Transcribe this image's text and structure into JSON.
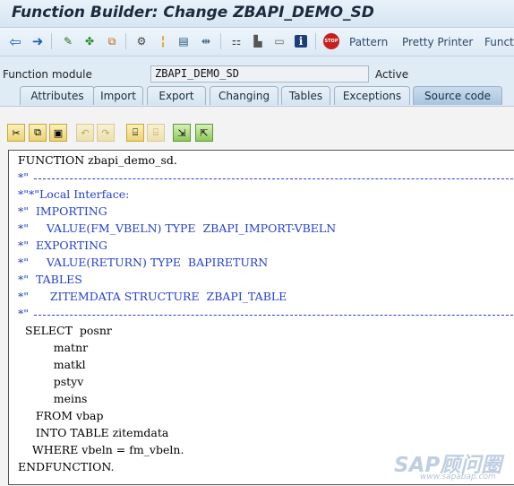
{
  "window": {
    "title": "Function Builder: Change ZBAPI_DEMO_SD"
  },
  "toolbar": {
    "buttons": [
      {
        "name": "back",
        "glyph": "⇦",
        "color": "#1a5fb0"
      },
      {
        "name": "forward",
        "glyph": "➜",
        "color": "#1a5fb0"
      },
      {
        "name": "display-change",
        "glyph": "✎",
        "color": "#2a6b1e"
      },
      {
        "name": "check",
        "glyph": "✤",
        "color": "#2d8a2d"
      },
      {
        "name": "activate",
        "glyph": "⧉",
        "color": "#c0620a"
      },
      {
        "name": "where-used",
        "glyph": "⚙",
        "color": "#444"
      },
      {
        "name": "set-breakpoint",
        "glyph": "¦",
        "color": "#d9a000"
      },
      {
        "name": "object-list",
        "glyph": "▤",
        "color": "#24527a"
      },
      {
        "name": "navigation",
        "glyph": "⇹",
        "color": "#24527a"
      },
      {
        "name": "hierarchy",
        "glyph": "⚏",
        "color": "#444"
      },
      {
        "name": "print",
        "glyph": "▙",
        "color": "#555"
      },
      {
        "name": "layout",
        "glyph": "▭",
        "color": "#666"
      },
      {
        "name": "information",
        "glyph": "i",
        "color": "#ffffff"
      },
      {
        "name": "stop",
        "glyph": "STOP",
        "color": "#ffffff"
      }
    ],
    "links": [
      "Pattern",
      "Pretty Printer",
      "Functi"
    ]
  },
  "function_module": {
    "label": "Function module",
    "value": "ZBAPI_DEMO_SD",
    "status": "Active"
  },
  "tabs": [
    {
      "label": "Attributes",
      "active": false
    },
    {
      "label": "Import",
      "active": false
    },
    {
      "label": "Export",
      "active": false
    },
    {
      "label": "Changing",
      "active": false
    },
    {
      "label": "Tables",
      "active": false
    },
    {
      "label": "Exceptions",
      "active": false
    },
    {
      "label": "Source code",
      "active": true
    }
  ],
  "editor_toolbar": [
    {
      "name": "cut",
      "glyph": "✂",
      "dim": false
    },
    {
      "name": "copy",
      "glyph": "⧉",
      "dim": false
    },
    {
      "name": "paste",
      "glyph": "▣",
      "dim": false
    },
    {
      "name": "undo",
      "glyph": "↶",
      "dim": true
    },
    {
      "name": "redo",
      "glyph": "↷",
      "dim": true
    },
    {
      "name": "find",
      "glyph": "⌸",
      "dim": false
    },
    {
      "name": "find-next",
      "glyph": "⌸",
      "dim": true
    },
    {
      "name": "insert-statement",
      "glyph": "⇲",
      "dim": false
    },
    {
      "name": "upload",
      "glyph": "⇱",
      "dim": false
    }
  ],
  "source": [
    {
      "text": "FUNCTION zbapi_demo_sd.",
      "comment": false,
      "dashed": false
    },
    {
      "text": "*\"",
      "comment": true,
      "dashed": true
    },
    {
      "text": "*\"*\"Local Interface:",
      "comment": true,
      "dashed": false
    },
    {
      "text": "*\"  IMPORTING",
      "comment": true,
      "dashed": false
    },
    {
      "text": "*\"     VALUE(FM_VBELN) TYPE  ZBAPI_IMPORT-VBELN",
      "comment": true,
      "dashed": false
    },
    {
      "text": "*\"  EXPORTING",
      "comment": true,
      "dashed": false
    },
    {
      "text": "*\"     VALUE(RETURN) TYPE  BAPIRETURN",
      "comment": true,
      "dashed": false
    },
    {
      "text": "*\"  TABLES",
      "comment": true,
      "dashed": false
    },
    {
      "text": "*\"      ZITEMDATA STRUCTURE  ZBAPI_TABLE",
      "comment": true,
      "dashed": false
    },
    {
      "text": "*\"",
      "comment": true,
      "dashed": true
    },
    {
      "text": "  SELECT  posnr",
      "comment": false,
      "dashed": false
    },
    {
      "text": "          matnr",
      "comment": false,
      "dashed": false
    },
    {
      "text": "          matkl",
      "comment": false,
      "dashed": false
    },
    {
      "text": "          pstyv",
      "comment": false,
      "dashed": false
    },
    {
      "text": "          meins",
      "comment": false,
      "dashed": false
    },
    {
      "text": "     FROM vbap",
      "comment": false,
      "dashed": false
    },
    {
      "text": "     INTO TABLE zitemdata",
      "comment": false,
      "dashed": false
    },
    {
      "text": "    WHERE vbeln = fm_vbeln.",
      "comment": false,
      "dashed": false
    },
    {
      "text": "ENDFUNCTION.",
      "comment": false,
      "dashed": false
    }
  ],
  "watermark": {
    "logo": "SAP顾问圈",
    "url": "www.sapabap.com"
  }
}
